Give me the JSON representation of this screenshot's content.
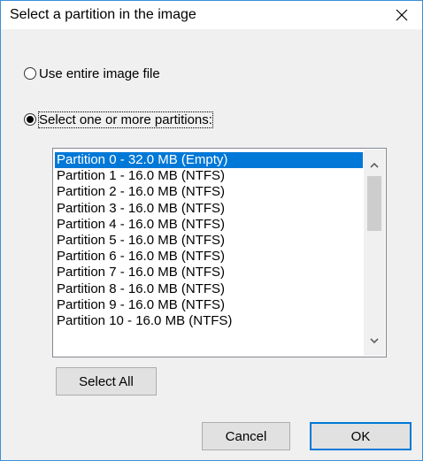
{
  "dialog": {
    "title": "Select a partition in the image"
  },
  "options": {
    "entire_label": "Use entire image file",
    "entire_selected": false,
    "partitions_label": "Select one or more partitions:",
    "partitions_selected": true
  },
  "partitions": {
    "items": [
      "Partition 0 - 32.0 MB (Empty)",
      "Partition 1 - 16.0 MB (NTFS)",
      "Partition 2 - 16.0 MB (NTFS)",
      "Partition 3 - 16.0 MB (NTFS)",
      "Partition 4 - 16.0 MB (NTFS)",
      "Partition 5 - 16.0 MB (NTFS)",
      "Partition 6 - 16.0 MB (NTFS)",
      "Partition 7 - 16.0 MB (NTFS)",
      "Partition 8 - 16.0 MB (NTFS)",
      "Partition 9 - 16.0 MB (NTFS)",
      "Partition 10 - 16.0 MB (NTFS)"
    ],
    "selected_index": 0
  },
  "buttons": {
    "select_all": "Select All",
    "cancel": "Cancel",
    "ok": "OK"
  },
  "icons": {
    "close": "close-icon",
    "scroll_up": "chevron-up-icon",
    "scroll_down": "chevron-down-icon"
  },
  "colors": {
    "accent": "#0078d7",
    "dialog_bg": "#f0f0f0",
    "window_border": "#3c8fd8"
  }
}
